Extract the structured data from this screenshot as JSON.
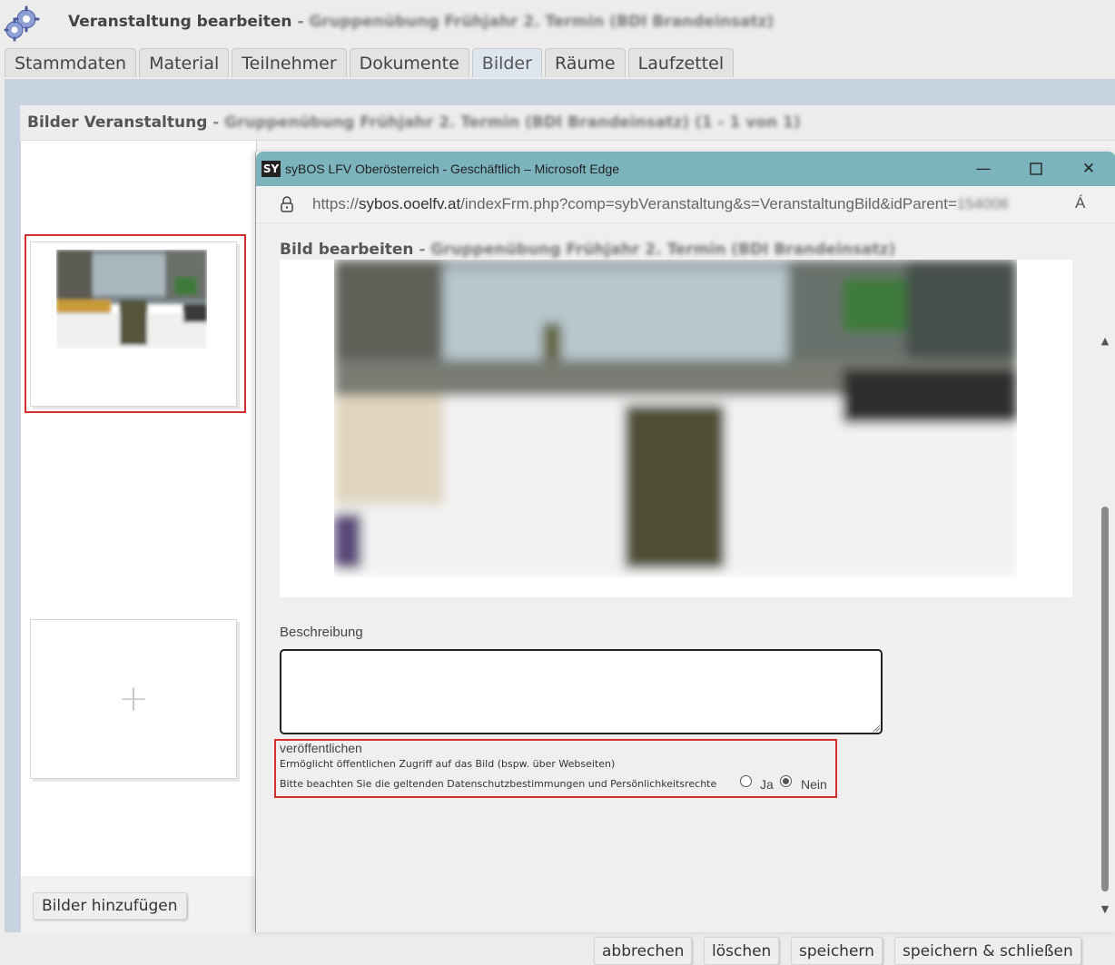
{
  "header": {
    "title": "Veranstaltung bearbeiten",
    "separator": "-",
    "title_detail_blurred": "Gruppenübung Frühjahr 2. Termin (BDI Brandeinsatz)"
  },
  "tabs": [
    {
      "label": "Stammdaten",
      "active": false
    },
    {
      "label": "Material",
      "active": false
    },
    {
      "label": "Teilnehmer",
      "active": false
    },
    {
      "label": "Dokumente",
      "active": false
    },
    {
      "label": "Bilder",
      "active": true
    },
    {
      "label": "Räume",
      "active": false
    },
    {
      "label": "Laufzettel",
      "active": false
    }
  ],
  "panel": {
    "title": "Bilder Veranstaltung",
    "separator": "-",
    "title_detail_blurred": "Gruppenübung Frühjahr 2. Termin (BDI Brandeinsatz) (1 - 1 von 1)",
    "add_button_label": "Bilder hinzufügen",
    "add_tile_icon": "plus-icon"
  },
  "popup": {
    "window_title": "syBOS LFV Oberösterreich - Geschäftlich – Microsoft Edge",
    "app_logo": "SY",
    "url_prefix": "https://",
    "url_host": "sybos.ooelfv.at",
    "url_path": "/indexFrm.php?comp=sybVeranstaltung&s=VeranstaltungBild&idParent=",
    "url_blurred_tail": "154008",
    "read_aloud": "Á",
    "controls": {
      "minimize": "—",
      "maximize": "☐",
      "close": "✕"
    },
    "edit_title": "Bild bearbeiten",
    "edit_separator": "-",
    "edit_title_detail_blurred": "Gruppenübung Frühjahr 2. Termin (BDI Brandeinsatz)",
    "description_label": "Beschreibung",
    "description_value": "",
    "publish": {
      "title": "veröffentlichen",
      "hint_line1": "Ermöglicht öffentlichen Zugriff auf das Bild (bspw. über Webseiten)",
      "hint_line2": "Bitte beachten Sie die geltenden Datenschutzbestimmungen und Persönlichkeitsrechte",
      "option_yes": "Ja",
      "option_no": "Nein",
      "selected": "Nein"
    },
    "buttons": {
      "cancel": "abbrechen",
      "delete": "löschen",
      "save": "speichern",
      "save_close": "speichern & schließen"
    }
  },
  "colors": {
    "titlebar": "#7cb4bd",
    "highlight_red": "#d62f2f",
    "frame_blue": "#c8d3e2"
  }
}
